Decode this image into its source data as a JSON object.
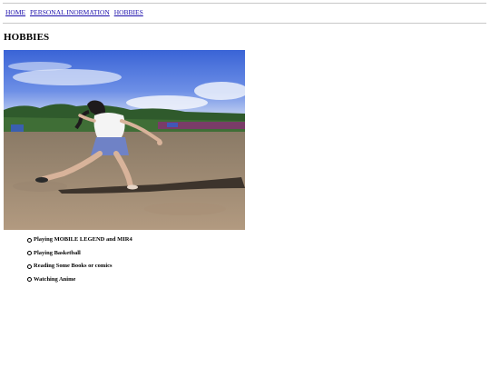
{
  "nav": {
    "links": [
      "HOME",
      "PERSONAL INORMATION",
      "HOBBIES"
    ]
  },
  "page": {
    "heading": "HOBBIES"
  },
  "hobbies": [
    "Playing MOBILE LEGEND and MIR4",
    "Playing Basketball",
    "Reading Some Books or comics",
    "Watching Anime"
  ],
  "colors": {
    "link": "#1a0dab",
    "rule": "#c8c8c8",
    "sky": "#4a6fd8",
    "sand": "#a08a73"
  }
}
